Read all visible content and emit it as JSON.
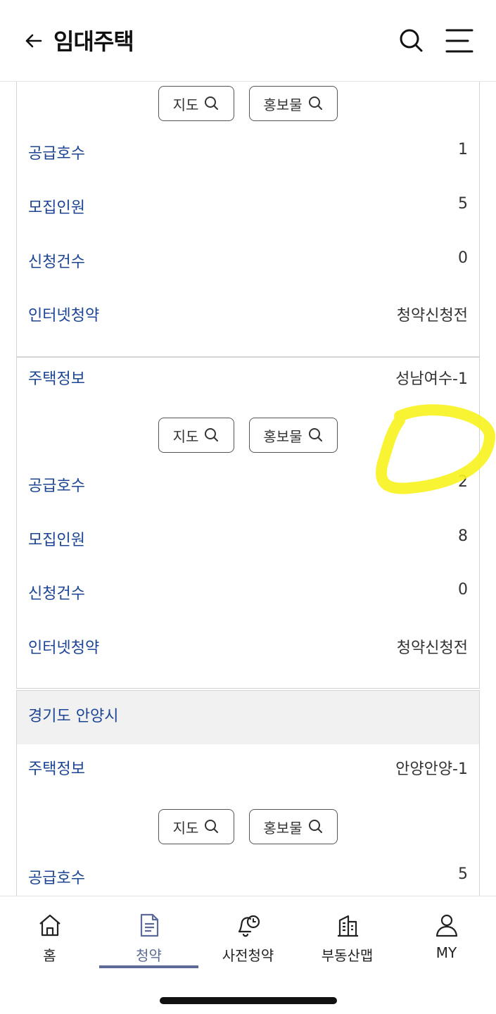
{
  "header": {
    "title": "임대주택"
  },
  "buttons": {
    "map": "지도",
    "promo": "홍보물"
  },
  "cards": [
    {
      "rows": [
        {
          "label": "공급호수",
          "value": "1"
        },
        {
          "label": "모집인원",
          "value": "5"
        },
        {
          "label": "신청건수",
          "value": "0"
        },
        {
          "label": "인터넷청약",
          "value": "청약신청전"
        }
      ]
    },
    {
      "housing_label": "주택정보",
      "housing_value": "성남여수-1",
      "rows": [
        {
          "label": "공급호수",
          "value": "2"
        },
        {
          "label": "모집인원",
          "value": "8"
        },
        {
          "label": "신청건수",
          "value": "0"
        },
        {
          "label": "인터넷청약",
          "value": "청약신청전"
        }
      ]
    },
    {
      "region": "경기도 안양시",
      "housing_label": "주택정보",
      "housing_value": "안양안양-1",
      "rows": [
        {
          "label": "공급호수",
          "value": "5"
        }
      ]
    }
  ],
  "tabs": [
    {
      "label": "홈",
      "icon": "home-icon"
    },
    {
      "label": "청약",
      "icon": "document-icon",
      "active": true
    },
    {
      "label": "사전청약",
      "icon": "bell-clock-icon"
    },
    {
      "label": "부동산맵",
      "icon": "building-icon"
    },
    {
      "label": "MY",
      "icon": "person-icon"
    }
  ],
  "colors": {
    "label_blue": "#1d4594",
    "active_tab": "#5b6a96",
    "highlight": "#f7f31e"
  }
}
